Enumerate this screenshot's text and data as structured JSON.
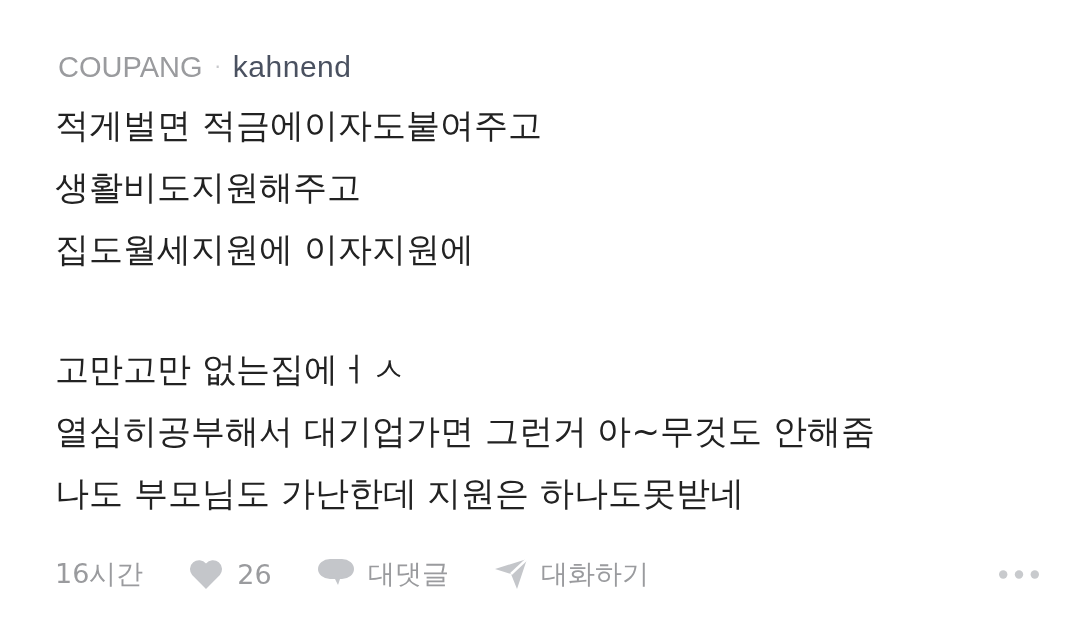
{
  "comment": {
    "source": "COUPANG",
    "separator": "·",
    "author": "kahnend",
    "paragraphs": [
      [
        "적게벌면 적금에이자도붙여주고",
        "생활비도지원해주고",
        "집도월세지원에 이자지원에"
      ],
      [
        "고만고만 없는집에ㅓㅅ",
        "열심히공부해서 대기업가면 그런거 아~무것도 안해줌",
        "나도 부모님도 가난한데 지원은 하나도못받네"
      ]
    ],
    "footer": {
      "time": "16시간",
      "likes": "26",
      "reply_label": "대댓글",
      "chat_label": "대화하기"
    }
  }
}
